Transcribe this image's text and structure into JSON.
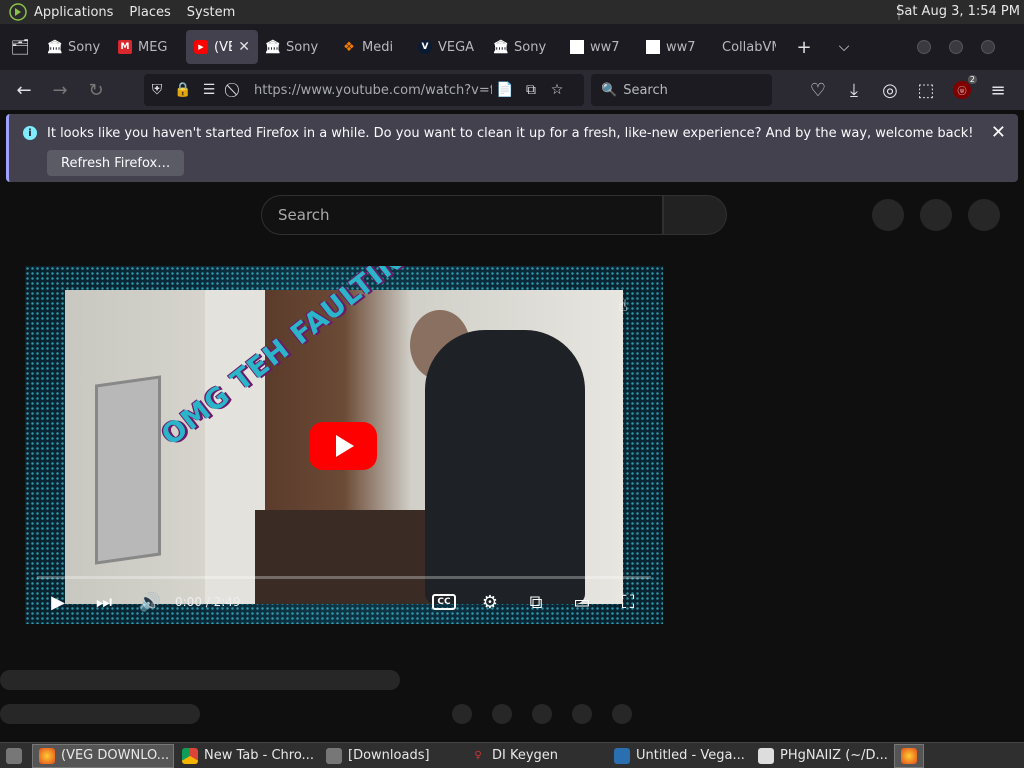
{
  "system_panel": {
    "menus": [
      "Applications",
      "Places",
      "System"
    ],
    "clock": "Sat Aug  3,  1:54 PM"
  },
  "tabs": [
    {
      "label": "Sony",
      "favicon": "building-icon"
    },
    {
      "label": "MEG",
      "favicon": "mega-icon"
    },
    {
      "label": "(VE",
      "favicon": "youtube-icon",
      "active": true
    },
    {
      "label": "Sony",
      "favicon": "building-icon"
    },
    {
      "label": "Medi",
      "favicon": "medium-icon"
    },
    {
      "label": "VEGA",
      "favicon": "vegas-icon"
    },
    {
      "label": "Sony",
      "favicon": "building-icon"
    },
    {
      "label": "ww7",
      "favicon": "blank-page-icon"
    },
    {
      "label": "ww7",
      "favicon": "blank-page-icon"
    },
    {
      "label": "CollabVM",
      "favicon": ""
    }
  ],
  "navbar": {
    "url": "https://www.youtube.com/watch?v=f",
    "search_placeholder": "Search",
    "ublock_badge": "2"
  },
  "notification": {
    "message": "It looks like you haven't started Firefox in a while. Do you want to clean it up for a fresh, like-new experience? And by the way, welcome back!",
    "button": "Refresh Firefox…"
  },
  "youtube": {
    "search_placeholder": "Search",
    "watermark": "OMG TEH FAULTINESS",
    "time": "0:00 / 2:49"
  },
  "taskbar": [
    {
      "label": "(VEG DOWNLO...",
      "icon": "firefox-icon",
      "active": true
    },
    {
      "label": "New Tab - Chro...",
      "icon": "chrome-icon"
    },
    {
      "label": "[Downloads]",
      "icon": "folder-icon"
    },
    {
      "label": "DI Keygen",
      "icon": "key-icon"
    },
    {
      "label": "Untitled - Vega...",
      "icon": "vegas-icon"
    },
    {
      "label": "PHgNAIIZ (~/D...",
      "icon": "text-editor-icon"
    }
  ]
}
